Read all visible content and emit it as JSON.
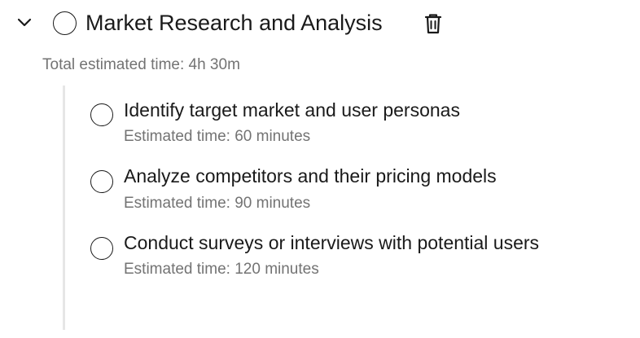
{
  "group": {
    "title": "Market Research and Analysis",
    "total_time": "Total estimated time: 4h 30m",
    "expanded": true,
    "completed": false
  },
  "icons": {
    "expand": "chevron-down-icon",
    "delete": "trash-icon",
    "checkbox": "circle-checkbox-icon"
  },
  "colors": {
    "text_primary": "#1a1a1a",
    "text_secondary": "#737373",
    "divider": "#e6e6e6",
    "background": "#ffffff"
  },
  "subtasks": [
    {
      "title": "Identify target market and user personas",
      "time": "Estimated time: 60 minutes",
      "completed": false
    },
    {
      "title": "Analyze competitors and their pricing models",
      "time": "Estimated time: 90 minutes",
      "completed": false
    },
    {
      "title": "Conduct surveys or interviews with potential users",
      "time": "Estimated time: 120 minutes",
      "completed": false
    }
  ]
}
